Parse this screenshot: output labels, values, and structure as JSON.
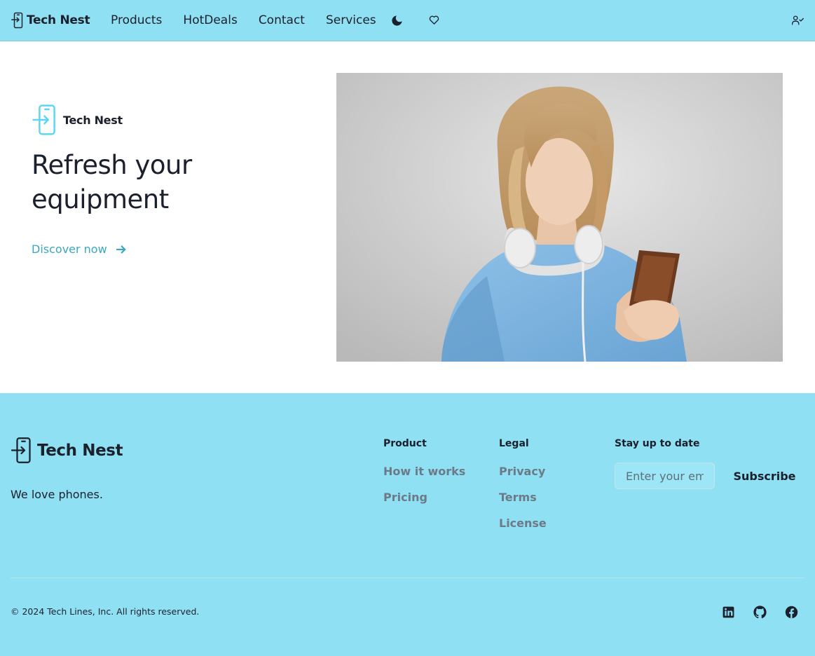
{
  "brand": {
    "name": "Tech Nest",
    "accent": "#3ba7c4",
    "bar_color": "#90e0f4"
  },
  "nav": {
    "links": [
      "Products",
      "HotDeals",
      "Contact",
      "Services"
    ],
    "icons": [
      "moon-icon",
      "heart-icon",
      "user-check-icon"
    ]
  },
  "hero": {
    "title": "Refresh your equipment",
    "cta": "Discover now"
  },
  "footer": {
    "tagline": "We love phones.",
    "product": {
      "title": "Product",
      "links": [
        "How it works",
        "Pricing"
      ]
    },
    "legal": {
      "title": "Legal",
      "links": [
        "Privacy",
        "Terms",
        "License"
      ]
    },
    "newsletter": {
      "title": "Stay up to date",
      "placeholder": "Enter your email",
      "button": "Subscribe"
    },
    "copyright": "© 2024 Tech Lines, Inc. All rights reserved.",
    "social": [
      "linkedin-icon",
      "github-icon",
      "facebook-icon"
    ]
  }
}
